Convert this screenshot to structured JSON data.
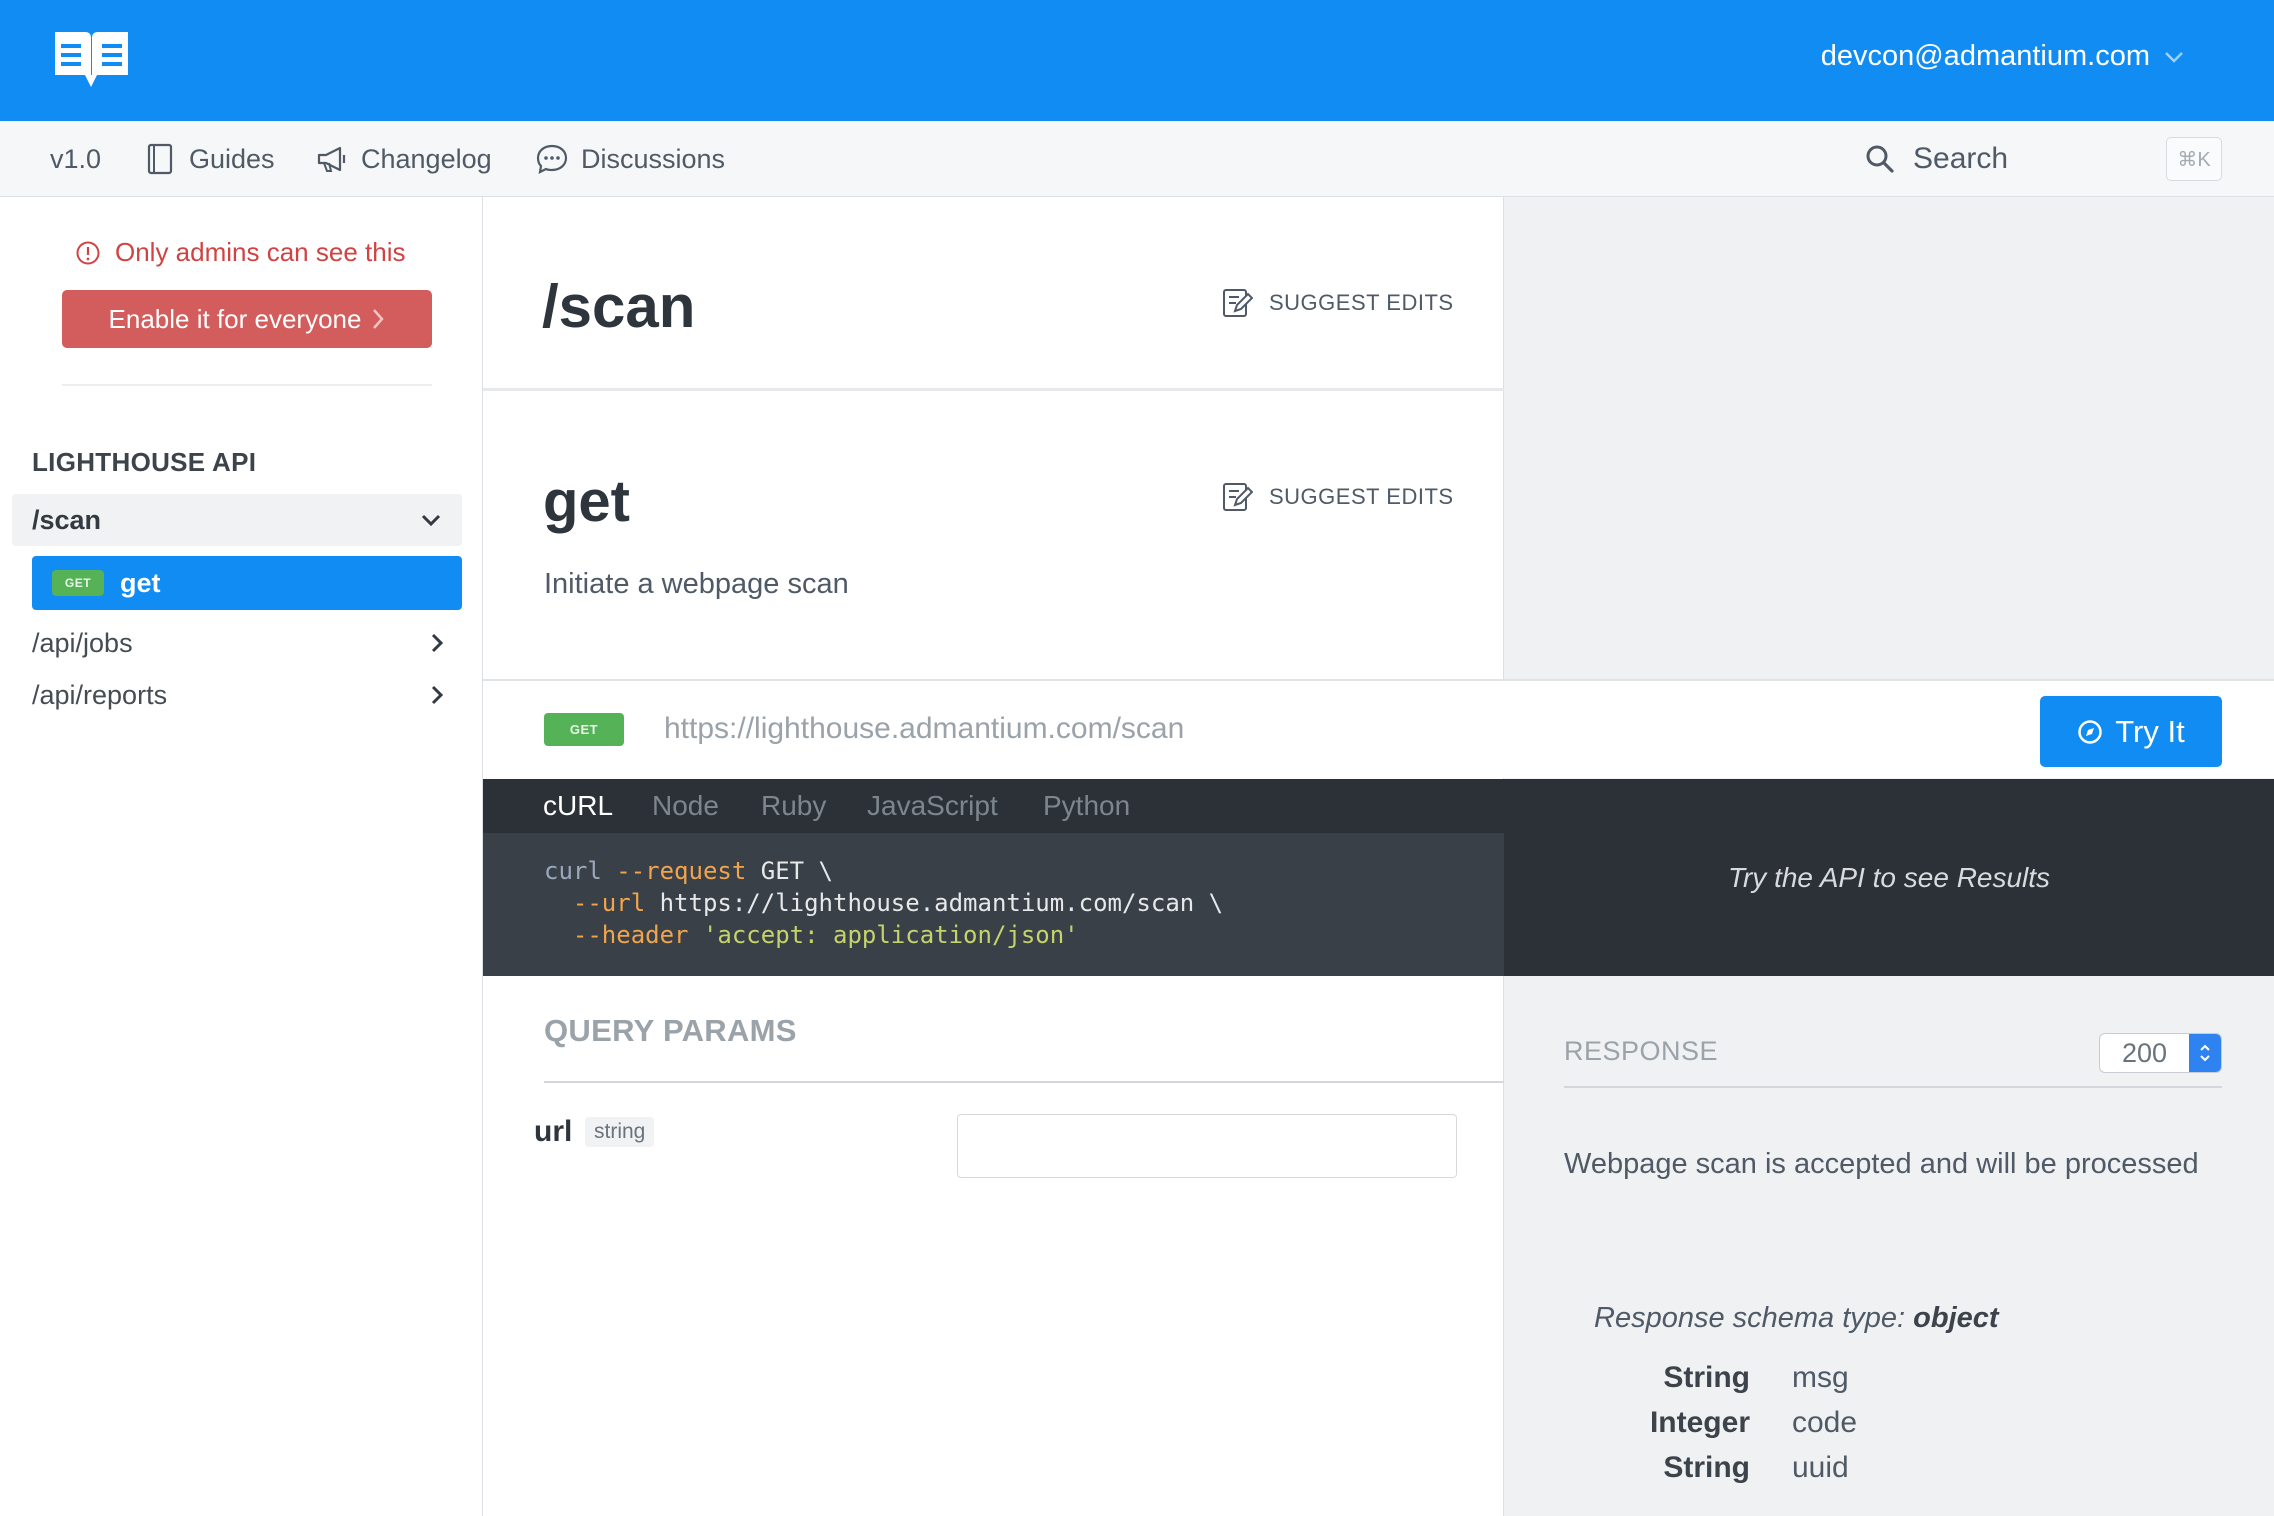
{
  "header": {
    "user_email": "devcon@admantium.com"
  },
  "subnav": {
    "version": "v1.0",
    "items": [
      {
        "label": "Guides",
        "icon": "book-icon"
      },
      {
        "label": "Changelog",
        "icon": "megaphone-icon"
      },
      {
        "label": "Discussions",
        "icon": "chat-bubble-icon"
      }
    ],
    "search_label": "Search",
    "search_shortcut": "⌘K"
  },
  "sidebar": {
    "admin_notice": "Only admins can see this",
    "enable_button": "Enable it for everyone",
    "section_heading": "LIGHTHOUSE API",
    "groups": [
      {
        "label": "/scan",
        "expanded": true,
        "children": [
          {
            "method": "GET",
            "label": "get",
            "active": true
          }
        ]
      },
      {
        "label": "/api/jobs",
        "expanded": false
      },
      {
        "label": "/api/reports",
        "expanded": false
      }
    ]
  },
  "main": {
    "page_title": "/scan",
    "suggest_edits": "SUGGEST EDITS",
    "operation_title": "get",
    "operation_description": "Initiate a webpage scan",
    "method_badge": "GET",
    "endpoint_url": "https://lighthouse.admantium.com/scan",
    "try_button": "Try It",
    "code_tabs": [
      "cURL",
      "Node",
      "Ruby",
      "JavaScript",
      "Python"
    ],
    "active_code_tab": "cURL",
    "code": {
      "line1_cmd": "curl",
      "line1_flag": "--request",
      "line1_rest": " GET \\",
      "line2_flag": "--url",
      "line2_rest": " https://lighthouse.admantium.com/scan \\",
      "line3_flag": "--header",
      "line3_str": "'accept: application/json'"
    },
    "results_hint": "Try the API to see Results",
    "query_params_heading": "QUERY PARAMS",
    "params": [
      {
        "name": "url",
        "type": "string",
        "value": ""
      }
    ]
  },
  "response": {
    "heading": "RESPONSE",
    "status_code": "200",
    "description": "Webpage scan is accepted and will be processed",
    "schema_type_label": "Response schema type: ",
    "schema_type_value": "object",
    "fields": [
      {
        "type": "String",
        "name": "msg"
      },
      {
        "type": "Integer",
        "name": "code"
      },
      {
        "type": "String",
        "name": "uuid"
      }
    ]
  },
  "colors": {
    "brand_blue": "#118cf3",
    "admin_red": "#d35c5c",
    "get_green": "#55b257",
    "code_bg": "#3a4048"
  }
}
